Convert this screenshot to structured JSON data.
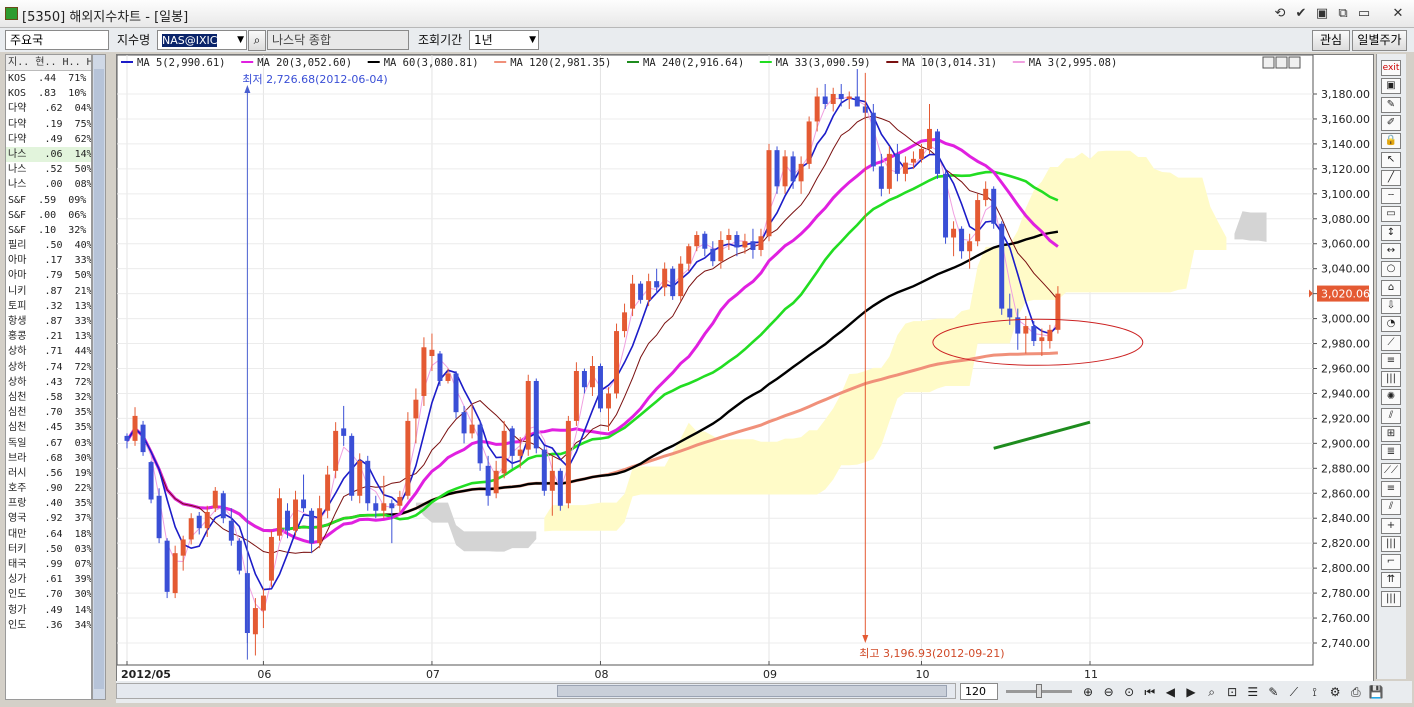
{
  "window": {
    "title": "[5350] 해외지수차트 - [일봉]",
    "controls": [
      "⟲",
      "✔",
      "▣",
      "⧉",
      "▭",
      "✕"
    ]
  },
  "toolbar": {
    "market_value": "주요국",
    "index_label": "지수명",
    "index_code": "NAS@IXIC",
    "index_name": "나스닥 종합",
    "period_label": "조회기간",
    "period_value": "1년",
    "watch_button": "관심",
    "daily_price_button": "일별주가"
  },
  "left_panel": {
    "header": "지.. 현.. H.. H..",
    "rows": [
      {
        "name": "KOS",
        "v1": ".44",
        "v2": "71%"
      },
      {
        "name": "KOS",
        "v1": ".83",
        "v2": "10%"
      },
      {
        "name": "다약",
        "v1": ".62",
        "v2": "04%"
      },
      {
        "name": "다약",
        "v1": ".19",
        "v2": "75%"
      },
      {
        "name": "다약",
        "v1": ".49",
        "v2": "62%"
      },
      {
        "name": "나스",
        "v1": ".06",
        "v2": "14%"
      },
      {
        "name": "나스",
        "v1": ".52",
        "v2": "50%"
      },
      {
        "name": "나스",
        "v1": ".00",
        "v2": "08%"
      },
      {
        "name": "S&F",
        "v1": ".59",
        "v2": "09%"
      },
      {
        "name": "S&F",
        "v1": ".00",
        "v2": "06%"
      },
      {
        "name": "S&F",
        "v1": ".10",
        "v2": "32%"
      },
      {
        "name": "필리",
        "v1": ".50",
        "v2": "40%"
      },
      {
        "name": "아마",
        "v1": ".17",
        "v2": "33%"
      },
      {
        "name": "아마",
        "v1": ".79",
        "v2": "50%"
      },
      {
        "name": "니키",
        "v1": ".87",
        "v2": "21%"
      },
      {
        "name": "토피",
        "v1": ".32",
        "v2": "13%"
      },
      {
        "name": "항생",
        "v1": ".87",
        "v2": "33%"
      },
      {
        "name": "홍콩",
        "v1": ".21",
        "v2": "13%"
      },
      {
        "name": "상하",
        "v1": ".71",
        "v2": "44%"
      },
      {
        "name": "상하",
        "v1": ".74",
        "v2": "72%"
      },
      {
        "name": "상하",
        "v1": ".43",
        "v2": "72%"
      },
      {
        "name": "심천",
        "v1": ".58",
        "v2": "32%"
      },
      {
        "name": "심천",
        "v1": ".70",
        "v2": "35%"
      },
      {
        "name": "심천",
        "v1": ".45",
        "v2": "35%"
      },
      {
        "name": "독일",
        "v1": ".67",
        "v2": "03%"
      },
      {
        "name": "브라",
        "v1": ".68",
        "v2": "30%"
      },
      {
        "name": "러시",
        "v1": ".56",
        "v2": "19%"
      },
      {
        "name": "호주",
        "v1": ".90",
        "v2": "22%"
      },
      {
        "name": "프랑",
        "v1": ".40",
        "v2": "35%"
      },
      {
        "name": "영국",
        "v1": ".92",
        "v2": "37%"
      },
      {
        "name": "대만",
        "v1": ".64",
        "v2": "18%"
      },
      {
        "name": "터키",
        "v1": ".50",
        "v2": "03%"
      },
      {
        "name": "태국",
        "v1": ".99",
        "v2": "07%"
      },
      {
        "name": "싱가",
        "v1": ".61",
        "v2": "39%"
      },
      {
        "name": "인도",
        "v1": ".70",
        "v2": "30%"
      },
      {
        "name": "헝가",
        "v1": ".49",
        "v2": "14%"
      },
      {
        "name": "인도",
        "v1": ".36",
        "v2": "34%"
      }
    ],
    "highlight_row": 5
  },
  "bottom": {
    "bar_count": "120",
    "icons": [
      "zoom-in-icon",
      "zoom-out-icon",
      "zoom-fit-icon",
      "first-icon",
      "prev-icon",
      "next-icon",
      "search-icon",
      "find-icon",
      "list-icon",
      "pen-icon",
      "indicator-icon",
      "chart-icon",
      "config-icon",
      "print-icon",
      "save-icon"
    ]
  },
  "right_tools": [
    "exit",
    "▣",
    "✎",
    "✐",
    "🔒",
    "↖",
    "╱",
    "┄",
    "▭",
    "↕",
    "↔",
    "○",
    "⌂",
    "⇩",
    "◔",
    "⟋",
    "≡",
    "|||",
    "✺",
    "⫽",
    "⊞",
    "≣",
    "⟋⟋",
    "≡",
    "⫽",
    "+",
    "|||",
    "⌐",
    "⇈",
    "|||"
  ],
  "chart_data": {
    "type": "candlestick",
    "legend": [
      {
        "label": "MA 5(2,990.61)",
        "color": "#1c1cc8"
      },
      {
        "label": "MA 20(3,052.60)",
        "color": "#e020e0"
      },
      {
        "label": "MA 60(3,080.81)",
        "color": "#000000"
      },
      {
        "label": "MA 120(2,981.35)",
        "color": "#f0907a"
      },
      {
        "label": "MA 240(2,916.64)",
        "color": "#1e8c1e"
      },
      {
        "label": "MA 33(3,090.59)",
        "color": "#22dd22"
      },
      {
        "label": "MA 10(3,014.31)",
        "color": "#7a1010"
      },
      {
        "label": "MA 3(2,995.08)",
        "color": "#f0a0e0"
      }
    ],
    "ylim": [
      2720,
      3200
    ],
    "yticks": [
      2740,
      2760,
      2780,
      2800,
      2820,
      2840,
      2860,
      2880,
      2900,
      2920,
      2940,
      2960,
      2980,
      3000,
      3020,
      3040,
      3060,
      3080,
      3100,
      3120,
      3140,
      3160,
      3180
    ],
    "ytick_labels": [
      "2,740.00",
      "2,760.00",
      "2,780.00",
      "2,800.00",
      "2,820.00",
      "2,840.00",
      "2,860.00",
      "2,880.00",
      "2,900.00",
      "2,920.00",
      "2,940.00",
      "2,960.00",
      "2,980.00",
      "3,000.00",
      "3,020.00",
      "3,040.00",
      "3,060.00",
      "3,080.00",
      "3,100.00",
      "3,120.00",
      "3,140.00",
      "3,160.00",
      "3,180.00"
    ],
    "current_value": "3,020.06",
    "current_price": 3020.06,
    "xlabels": [
      {
        "label": "2012/05",
        "index": 0
      },
      {
        "label": "06",
        "index": 17
      },
      {
        "label": "07",
        "index": 38
      },
      {
        "label": "08",
        "index": 59
      },
      {
        "label": "09",
        "index": 80
      },
      {
        "label": "10",
        "index": 99
      },
      {
        "label": "11",
        "index": 120
      }
    ],
    "annotations": {
      "low": {
        "label": "최저 2,726.68(2012-06-04)",
        "index": 15,
        "value": 2726.68
      },
      "high": {
        "label": "최고 3,196.93(2012-09-21)",
        "index": 92,
        "value": 3196.93
      }
    },
    "candles": [
      [
        2906,
        2908,
        2896,
        2902
      ],
      [
        2902,
        2929,
        2898,
        2922
      ],
      [
        2915,
        2918,
        2890,
        2893
      ],
      [
        2885,
        2886,
        2852,
        2855
      ],
      [
        2858,
        2864,
        2820,
        2824
      ],
      [
        2822,
        2824,
        2776,
        2781
      ],
      [
        2780,
        2818,
        2776,
        2812
      ],
      [
        2810,
        2826,
        2798,
        2823
      ],
      [
        2823,
        2844,
        2819,
        2840
      ],
      [
        2842,
        2845,
        2827,
        2832
      ],
      [
        2832,
        2850,
        2825,
        2845
      ],
      [
        2848,
        2865,
        2845,
        2862
      ],
      [
        2860,
        2862,
        2836,
        2840
      ],
      [
        2838,
        2848,
        2818,
        2822
      ],
      [
        2822,
        2824,
        2795,
        2798
      ],
      [
        2796,
        2798,
        2740,
        2748
      ],
      [
        2747,
        2776,
        2730,
        2768
      ],
      [
        2766,
        2784,
        2752,
        2778
      ],
      [
        2790,
        2830,
        2785,
        2825
      ],
      [
        2826,
        2864,
        2822,
        2856
      ],
      [
        2846,
        2852,
        2824,
        2830
      ],
      [
        2830,
        2862,
        2826,
        2855
      ],
      [
        2855,
        2875,
        2845,
        2848
      ],
      [
        2846,
        2848,
        2812,
        2820
      ],
      [
        2820,
        2858,
        2816,
        2848
      ],
      [
        2846,
        2882,
        2840,
        2875
      ],
      [
        2878,
        2917,
        2872,
        2910
      ],
      [
        2912,
        2930,
        2898,
        2906
      ],
      [
        2906,
        2908,
        2854,
        2858
      ],
      [
        2858,
        2892,
        2852,
        2886
      ],
      [
        2886,
        2890,
        2846,
        2852
      ],
      [
        2852,
        2858,
        2840,
        2846
      ],
      [
        2846,
        2874,
        2840,
        2852
      ],
      [
        2852,
        2855,
        2820,
        2848
      ],
      [
        2850,
        2862,
        2845,
        2857
      ],
      [
        2858,
        2925,
        2855,
        2918
      ],
      [
        2920,
        2944,
        2900,
        2935
      ],
      [
        2938,
        2985,
        2930,
        2977
      ],
      [
        2970,
        2988,
        2958,
        2975
      ],
      [
        2972,
        2974,
        2946,
        2950
      ],
      [
        2950,
        2960,
        2948,
        2956
      ],
      [
        2956,
        2958,
        2920,
        2925
      ],
      [
        2925,
        2930,
        2900,
        2908
      ],
      [
        2908,
        2932,
        2904,
        2915
      ],
      [
        2915,
        2918,
        2878,
        2884
      ],
      [
        2882,
        2890,
        2850,
        2858
      ],
      [
        2860,
        2886,
        2856,
        2878
      ],
      [
        2876,
        2918,
        2872,
        2910
      ],
      [
        2912,
        2914,
        2880,
        2890
      ],
      [
        2890,
        2905,
        2880,
        2895
      ],
      [
        2895,
        2955,
        2890,
        2950
      ],
      [
        2950,
        2952,
        2892,
        2896
      ],
      [
        2895,
        2898,
        2858,
        2862
      ],
      [
        2862,
        2890,
        2842,
        2878
      ],
      [
        2878,
        2880,
        2846,
        2850
      ],
      [
        2852,
        2922,
        2848,
        2918
      ],
      [
        2918,
        2965,
        2914,
        2958
      ],
      [
        2958,
        2960,
        2940,
        2945
      ],
      [
        2945,
        2970,
        2938,
        2962
      ],
      [
        2962,
        2964,
        2925,
        2928
      ],
      [
        2928,
        2945,
        2910,
        2940
      ],
      [
        2940,
        2996,
        2936,
        2990
      ],
      [
        2990,
        3012,
        2985,
        3005
      ],
      [
        3008,
        3035,
        3002,
        3028
      ],
      [
        3028,
        3030,
        3012,
        3015
      ],
      [
        3015,
        3036,
        3010,
        3030
      ],
      [
        3030,
        3040,
        3020,
        3025
      ],
      [
        3025,
        3045,
        3018,
        3040
      ],
      [
        3040,
        3042,
        3015,
        3018
      ],
      [
        3018,
        3050,
        3014,
        3044
      ],
      [
        3044,
        3060,
        3038,
        3058
      ],
      [
        3058,
        3070,
        3054,
        3067
      ],
      [
        3068,
        3070,
        3050,
        3056
      ],
      [
        3056,
        3062,
        3042,
        3046
      ],
      [
        3046,
        3070,
        3040,
        3063
      ],
      [
        3063,
        3072,
        3055,
        3067
      ],
      [
        3067,
        3070,
        3050,
        3057
      ],
      [
        3057,
        3068,
        3052,
        3062
      ],
      [
        3062,
        3072,
        3048,
        3055
      ],
      [
        3055,
        3072,
        3050,
        3066
      ],
      [
        3066,
        3140,
        3062,
        3135
      ],
      [
        3135,
        3138,
        3100,
        3106
      ],
      [
        3106,
        3135,
        3100,
        3130
      ],
      [
        3130,
        3134,
        3104,
        3110
      ],
      [
        3110,
        3130,
        3100,
        3124
      ],
      [
        3124,
        3162,
        3120,
        3158
      ],
      [
        3158,
        3185,
        3150,
        3178
      ],
      [
        3178,
        3188,
        3168,
        3172
      ],
      [
        3172,
        3185,
        3166,
        3180
      ],
      [
        3180,
        3188,
        3170,
        3176
      ],
      [
        3176,
        3182,
        3168,
        3178
      ],
      [
        3178,
        3200,
        3170,
        3170
      ],
      [
        3170,
        3172,
        3160,
        3165
      ],
      [
        3165,
        3172,
        3118,
        3122
      ],
      [
        3122,
        3132,
        3098,
        3104
      ],
      [
        3104,
        3138,
        3100,
        3132
      ],
      [
        3132,
        3140,
        3110,
        3116
      ],
      [
        3116,
        3130,
        3110,
        3125
      ],
      [
        3125,
        3134,
        3120,
        3128
      ],
      [
        3128,
        3140,
        3125,
        3136
      ],
      [
        3136,
        3172,
        3132,
        3152
      ],
      [
        3150,
        3152,
        3112,
        3116
      ],
      [
        3116,
        3118,
        3060,
        3065
      ],
      [
        3065,
        3078,
        3050,
        3072
      ],
      [
        3072,
        3074,
        3048,
        3054
      ],
      [
        3054,
        3068,
        3040,
        3062
      ],
      [
        3062,
        3100,
        3058,
        3095
      ],
      [
        3095,
        3110,
        3090,
        3104
      ],
      [
        3104,
        3106,
        3072,
        3076
      ],
      [
        3076,
        3078,
        3003,
        3008
      ],
      [
        3008,
        3020,
        2995,
        3001
      ],
      [
        3001,
        3008,
        2975,
        2988
      ],
      [
        2988,
        3002,
        2972,
        2994
      ],
      [
        2994,
        2998,
        2978,
        2982
      ],
      [
        2982,
        2992,
        2970,
        2985
      ],
      [
        2982,
        2995,
        2976,
        2991
      ],
      [
        2991,
        3026,
        2988,
        3020
      ]
    ]
  }
}
